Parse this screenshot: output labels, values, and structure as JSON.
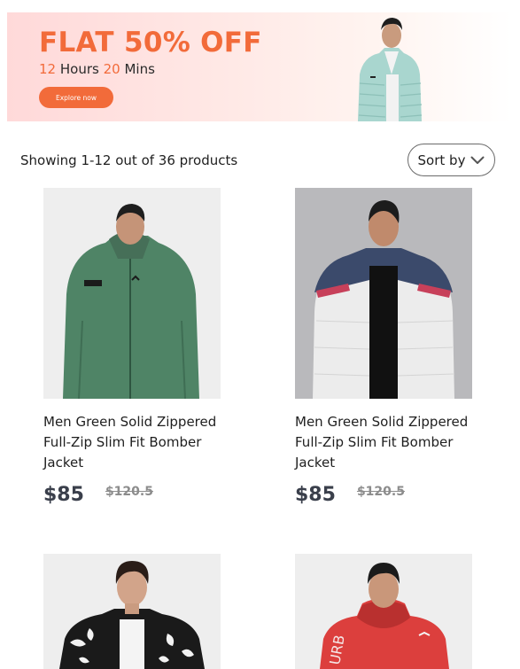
{
  "banner": {
    "title": "FLAT 50% OFF",
    "timer": {
      "hours": "12",
      "hours_label": "Hours",
      "mins": "20",
      "mins_label": "Mins"
    },
    "button_label": "Explore now",
    "accent_color": "#f26b3a"
  },
  "toolbar": {
    "results_text": "Showing 1-12 out of 36 products",
    "sort_label": "Sort by",
    "sort_icon": "chevron-down-icon"
  },
  "products": [
    {
      "title": "Men Green Solid Zippered Full-Zip Slim Fit Bomber Jacket",
      "price": "$85",
      "old_price": "$120.5",
      "image": "green-zip-hoodie-photo"
    },
    {
      "title": "Men Green Solid Zippered Full-Zip Slim Fit Bomber Jacket",
      "price": "$85",
      "old_price": "$120.5",
      "image": "white-navy-puffer-jacket-photo"
    },
    {
      "title": "",
      "price": "",
      "old_price": "",
      "image": "black-white-print-jacket-photo"
    },
    {
      "title": "",
      "price": "",
      "old_price": "",
      "image": "red-hooded-jacket-photo"
    }
  ]
}
